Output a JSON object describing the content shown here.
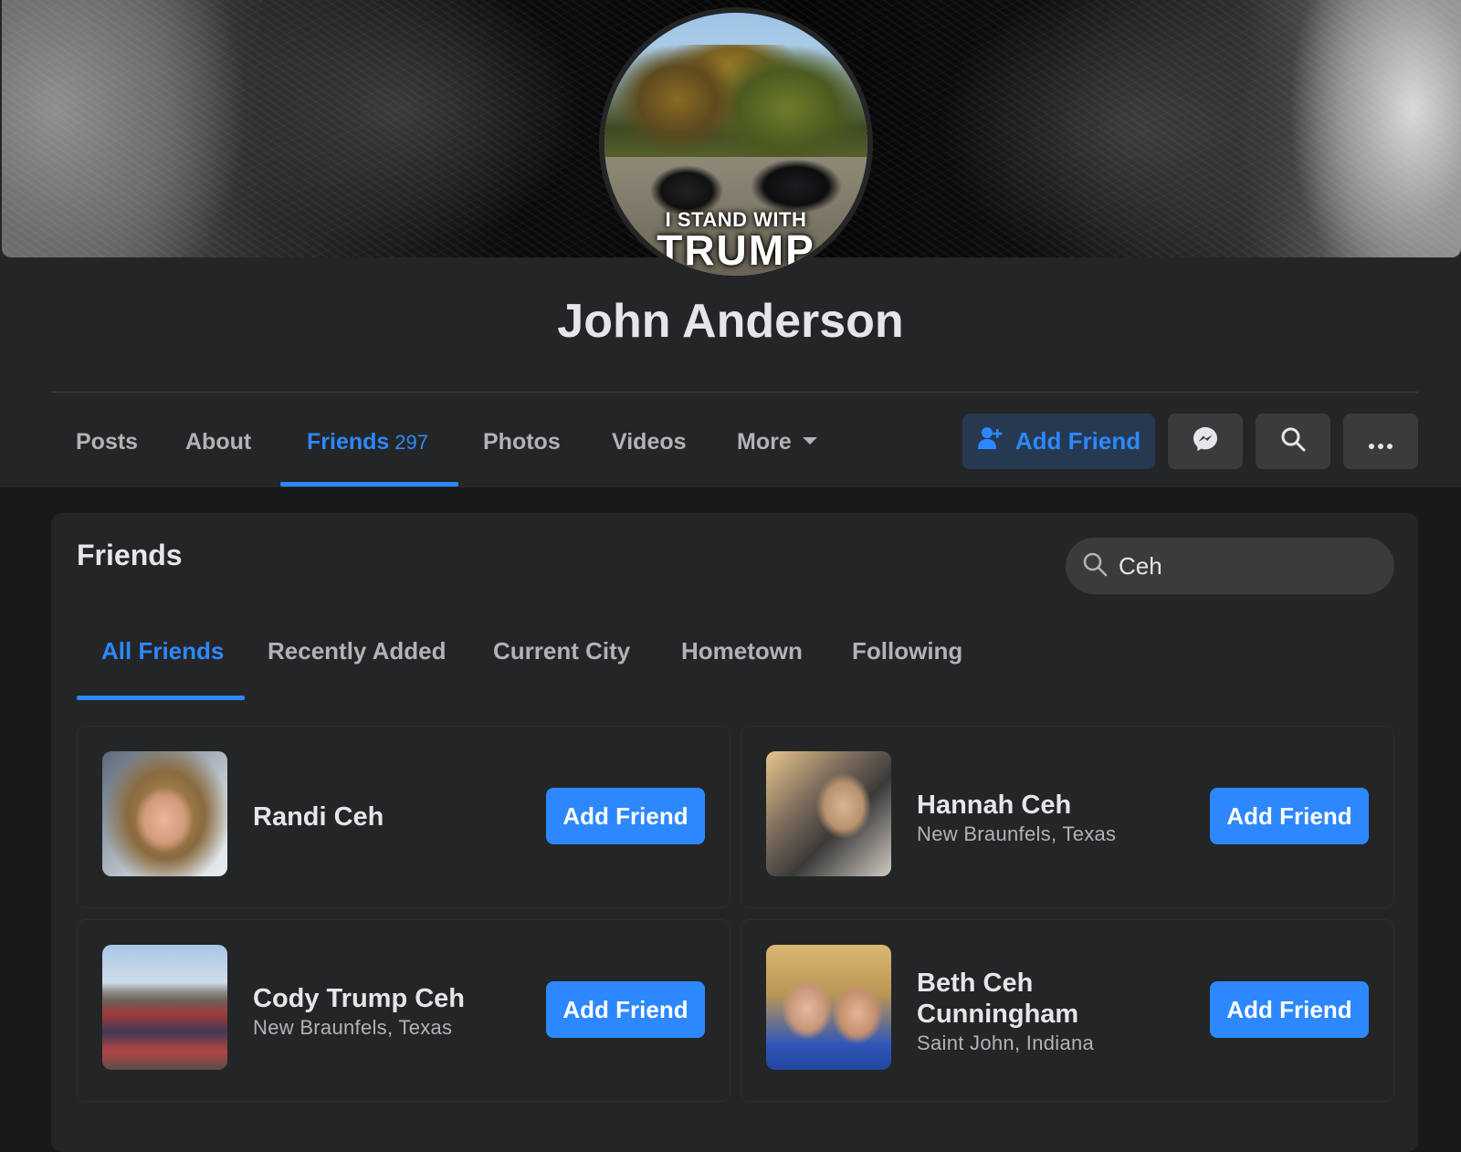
{
  "profile": {
    "name": "John Anderson",
    "avatar_line1": "I STAND WITH",
    "avatar_line2": "TRUMP"
  },
  "profile_tabs": [
    {
      "label": "Posts"
    },
    {
      "label": "About"
    },
    {
      "label": "Friends",
      "count": "297",
      "active": true
    },
    {
      "label": "Photos"
    },
    {
      "label": "Videos"
    },
    {
      "label": "More"
    }
  ],
  "header_actions": {
    "add_friend_label": "Add Friend",
    "icons": [
      "add-user-icon",
      "messenger-icon",
      "search-icon",
      "more-dots-icon"
    ]
  },
  "friends_section": {
    "title": "Friends",
    "search_value": "Ceh",
    "tabs": [
      {
        "label": "All Friends",
        "active": true
      },
      {
        "label": "Recently Added"
      },
      {
        "label": "Current City"
      },
      {
        "label": "Hometown"
      },
      {
        "label": "Following"
      }
    ],
    "friends": [
      {
        "name": "Randi Ceh",
        "location": "",
        "button": "Add Friend"
      },
      {
        "name": "Hannah Ceh",
        "location": "New Braunfels, Texas",
        "button": "Add Friend"
      },
      {
        "name": "Cody Trump Ceh",
        "location": "New Braunfels, Texas",
        "button": "Add Friend"
      },
      {
        "name": "Beth Ceh Cunningham",
        "location": "Saint John, Indiana",
        "button": "Add Friend"
      }
    ]
  },
  "colors": {
    "accent": "#2d88ff",
    "surface": "#242526",
    "background": "#18191a",
    "button_secondary": "#3a3b3c"
  }
}
